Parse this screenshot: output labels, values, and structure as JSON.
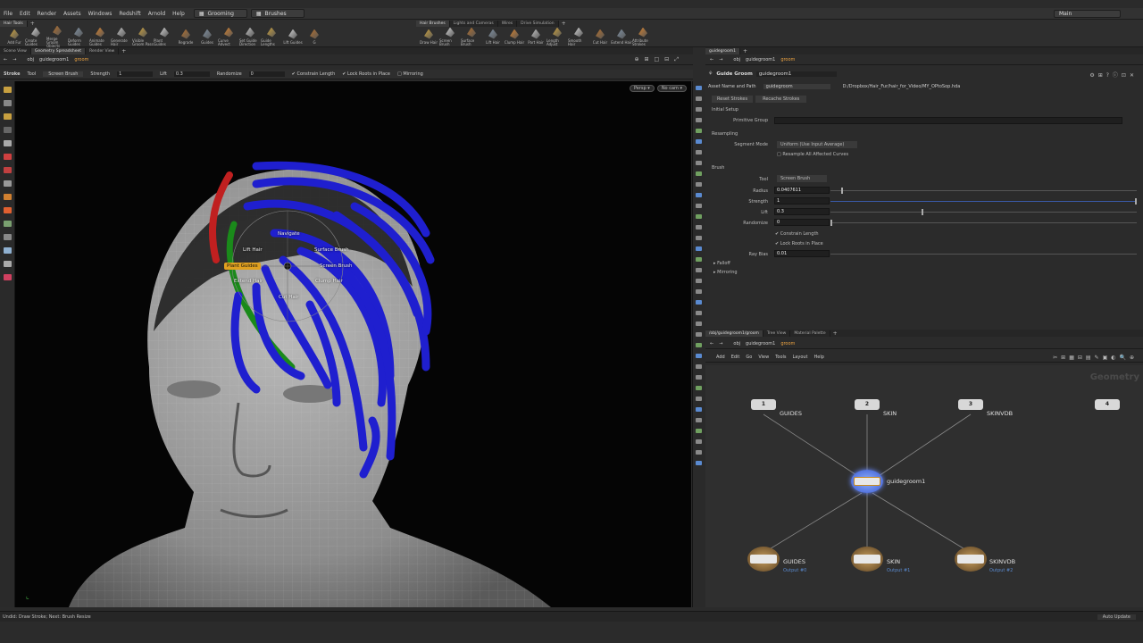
{
  "menubar": {
    "items": [
      "File",
      "Edit",
      "Render",
      "Assets",
      "Windows",
      "Redshift",
      "Arnold",
      "Help"
    ],
    "desktop": "Grooming",
    "shelfset": "Brushes",
    "main": "Main"
  },
  "shelf_left": {
    "tabs": [
      "Hair Tools"
    ],
    "tools": [
      "Add Fur",
      "Create Guides",
      "Merge Groom Objects",
      "Deform Guides",
      "Animate Guides",
      "Generate Hair",
      "Visible Groom Pass",
      "Plant Guides",
      "Regrade",
      "Guides",
      "Curve Advect",
      "Set Guide Direction",
      "Guide Lengths",
      "Lift Guides",
      "G"
    ]
  },
  "shelf_right": {
    "tabs": [
      "Hair Brushes",
      "Lights and Cameras",
      "Wires",
      "Drive Simulation"
    ],
    "tools": [
      "Draw Hair",
      "Screen Brush",
      "Surface Brush",
      "Lift Hair",
      "Clump Hair",
      "Part Hair",
      "Length Adjust",
      "Smooth Hair",
      "Cut Hair",
      "Extend Hair",
      "Attribute Strokes"
    ]
  },
  "viewer": {
    "tabs": [
      "Scene View",
      "Geometry Spreadsheet",
      "Render View"
    ],
    "path": [
      "obj",
      "guidegroom1",
      "groom"
    ],
    "toolbar": {
      "stroke": "Stroke",
      "tool_label": "Tool",
      "tool_value": "Screen Brush",
      "strength_label": "Strength",
      "strength_value": "1",
      "lift_label": "Lift",
      "lift_value": "0.3",
      "randomize_label": "Randomize",
      "randomize_value": "0",
      "constrain": "Constrain Length",
      "lock_roots": "Lock Roots in Place",
      "mirroring": "Mirroring"
    },
    "persp": "Persp",
    "cam": "No cam",
    "radial": {
      "navigate": "Navigate",
      "lift": "Lift Hair",
      "surface": "Surface Brush",
      "plant": "Plant Guides",
      "screen": "Screen Brush",
      "extend": "Extend Hair",
      "clump": "Clump Hair",
      "cut": "Cut Hair"
    }
  },
  "params": {
    "tab": "guidegroom1",
    "path": [
      "obj",
      "guidegroom1",
      "groom"
    ],
    "node_type": "Guide Groom",
    "node_name": "guidegroom1",
    "asset_label": "Asset Name and Path",
    "asset_value": "guidegroom",
    "asset_path": "D:/Dropbox/Hair_Fur/hair_for_Video/MY_OPtoSop.hda",
    "buttons": [
      "Reset Strokes",
      "Recache Strokes"
    ],
    "initial_setup": "Initial Setup",
    "primitive_group": "Primitive Group",
    "resampling": "Resampling",
    "segment_mode_label": "Segment Mode",
    "segment_mode_value": "Uniform (Use Input Average)",
    "resample_all": "Resample All Affected Curves",
    "brush": "Brush",
    "tool_label": "Tool",
    "tool_value": "Screen Brush",
    "radius_label": "Radius",
    "radius_value": "0.0407611",
    "strength_label": "Strength",
    "strength_value": "1",
    "lift_label": "Lift",
    "lift_value": "0.3",
    "randomize_label": "Randomize",
    "randomize_value": "0",
    "constrain": "Constrain Length",
    "lock_roots": "Lock Roots in Place",
    "ray_bias_label": "Ray Bias",
    "ray_bias_value": "0.01",
    "falloff": "Falloff",
    "mirroring": "Mirroring"
  },
  "network": {
    "tabs": [
      "/obj/guidegroom1/groom",
      "Tree View",
      "Material Palette"
    ],
    "path": [
      "obj",
      "guidegroom1",
      "groom"
    ],
    "menu": [
      "Add",
      "Edit",
      "Go",
      "View",
      "Tools",
      "Layout",
      "Help"
    ],
    "context": "Geometry",
    "inputs": [
      {
        "num": "1",
        "label": "GUIDES"
      },
      {
        "num": "2",
        "label": "SKIN"
      },
      {
        "num": "3",
        "label": "SKINVDB"
      },
      {
        "num": "4",
        "label": ""
      }
    ],
    "center": "guidegroom1",
    "outputs": [
      {
        "label": "GUIDES",
        "sub": "Output #0"
      },
      {
        "label": "SKIN",
        "sub": "Output #1"
      },
      {
        "label": "SKINVDB",
        "sub": "Output #2"
      }
    ]
  },
  "status": {
    "text": "Undid: Draw Stroke; Next: Brush Resize",
    "update": "Auto Update"
  }
}
